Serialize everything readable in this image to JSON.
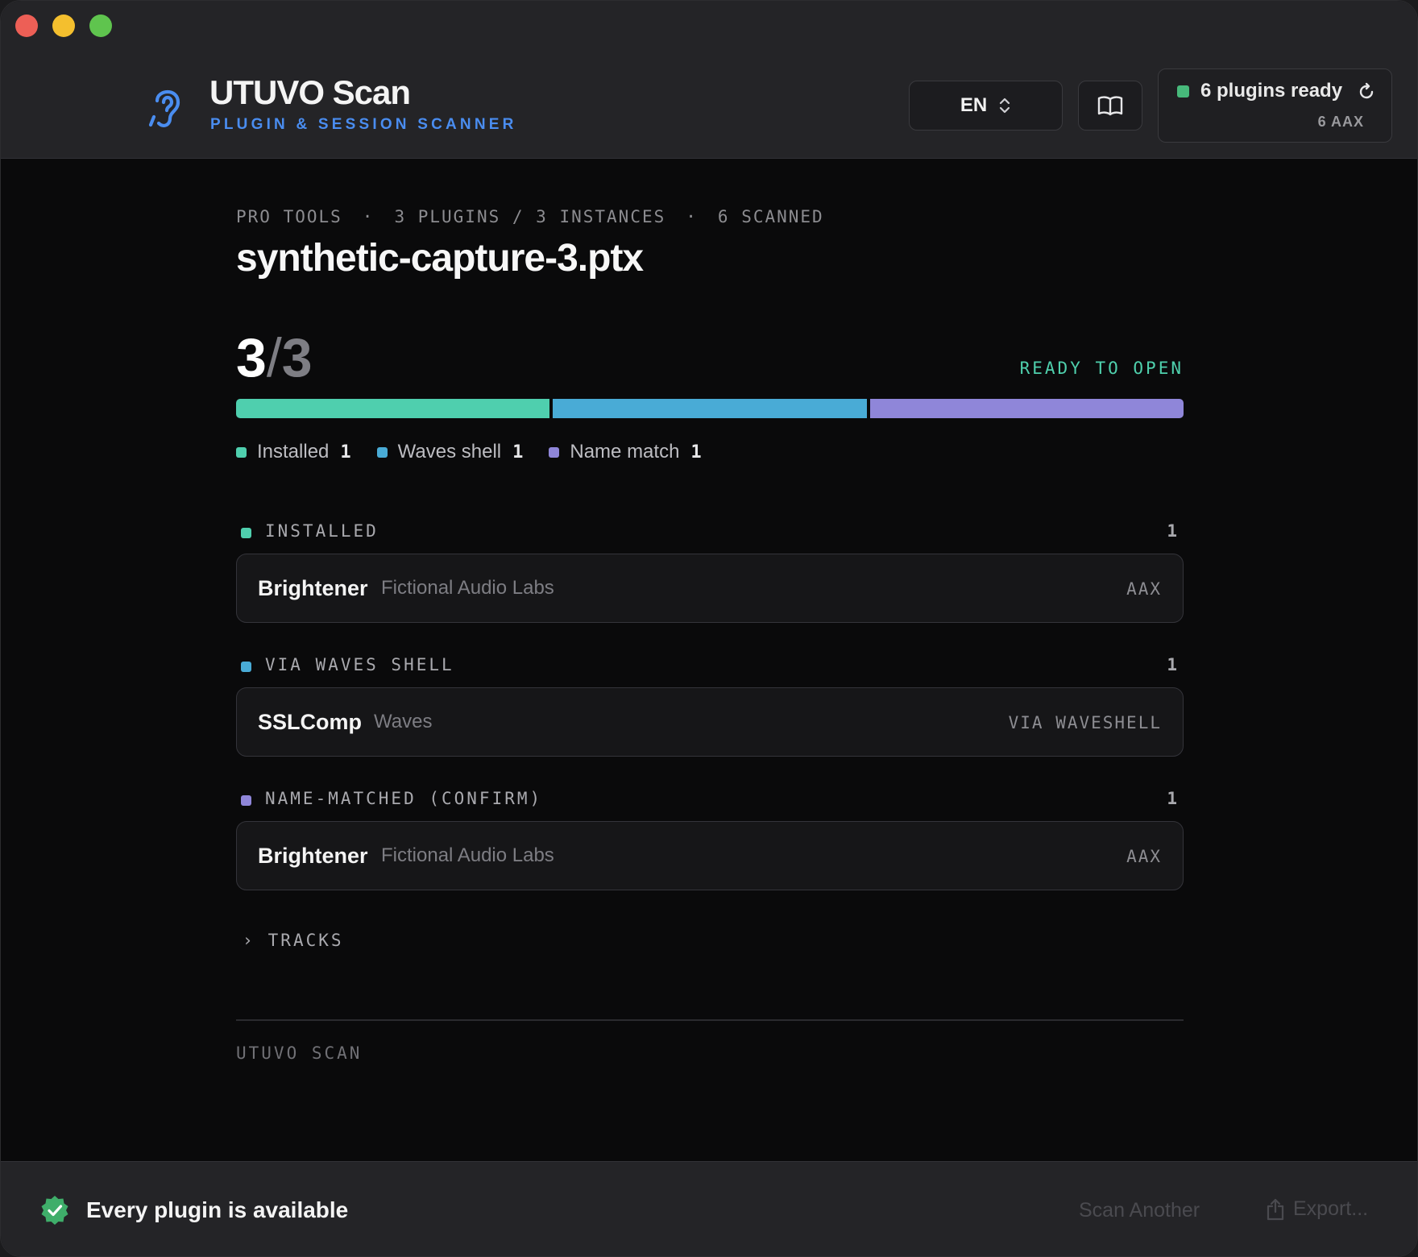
{
  "app": {
    "name": "UTUVO Scan",
    "subtitle": "PLUGIN & SESSION SCANNER"
  },
  "header": {
    "language": "EN",
    "status": {
      "label": "6 plugins ready",
      "sub": "6 AAX",
      "color": "#47b97b"
    }
  },
  "session": {
    "meta": [
      "PRO TOOLS",
      "3 PLUGINS / 3 INSTANCES",
      "6 SCANNED"
    ],
    "meta_separator": "·",
    "filename": "synthetic-capture-3.ptx",
    "score_found": "3",
    "score_sep": "/",
    "score_total": "3",
    "state": "READY TO OPEN"
  },
  "breakdown": [
    {
      "label": "Installed",
      "count": "1",
      "color": "#4fcfae",
      "fraction": 0.3333
    },
    {
      "label": "Waves shell",
      "count": "1",
      "color": "#49abd6",
      "fraction": 0.3333
    },
    {
      "label": "Name match",
      "count": "1",
      "color": "#8f86d9",
      "fraction": 0.3333
    }
  ],
  "groups": [
    {
      "label": "INSTALLED",
      "count": "1",
      "color": "#4fcfae",
      "items": [
        {
          "name": "Brightener",
          "vendor": "Fictional Audio Labs",
          "format": "AAX"
        }
      ]
    },
    {
      "label": "VIA WAVES SHELL",
      "count": "1",
      "color": "#49abd6",
      "items": [
        {
          "name": "SSLComp",
          "vendor": "Waves",
          "format": "VIA WAVESHELL"
        }
      ]
    },
    {
      "label": "NAME-MATCHED (CONFIRM)",
      "count": "1",
      "color": "#8f86d9",
      "items": [
        {
          "name": "Brightener",
          "vendor": "Fictional Audio Labs",
          "format": "AAX"
        }
      ]
    }
  ],
  "tracks": {
    "chevron": "›",
    "label": "TRACKS"
  },
  "footer": {
    "brand": "UTUVO SCAN"
  },
  "bottom_bar": {
    "message": "Every plugin is available",
    "scan_another": "Scan Another",
    "export": "Export..."
  },
  "icons": {
    "brand": "ear-icon",
    "language_toggle": "chevron-updown-icon",
    "docs": "book-icon",
    "refresh": "refresh-icon",
    "success": "check-badge-icon",
    "export": "share-icon"
  }
}
